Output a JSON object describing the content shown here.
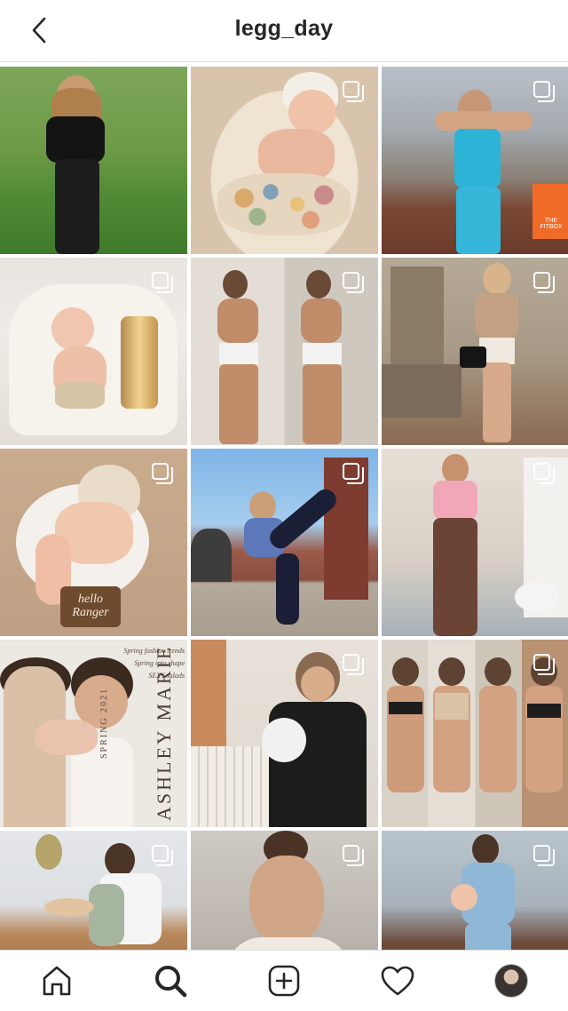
{
  "header": {
    "title": "legg_day"
  },
  "grid": {
    "tiles": [
      {
        "row": 1,
        "col": 1,
        "multi": false,
        "desc": "woman-black-top-garden"
      },
      {
        "row": 1,
        "col": 2,
        "multi": true,
        "desc": "baby-easter-eggs"
      },
      {
        "row": 1,
        "col": 3,
        "multi": true,
        "desc": "woman-flexing-fitbox"
      },
      {
        "row": 2,
        "col": 1,
        "multi": true,
        "desc": "baby-number-one-balloon"
      },
      {
        "row": 2,
        "col": 2,
        "multi": true,
        "desc": "pregnancy-mirror-selfie"
      },
      {
        "row": 2,
        "col": 3,
        "multi": true,
        "desc": "woman-porch-handbag"
      },
      {
        "row": 3,
        "col": 1,
        "multi": true,
        "desc": "newborn-hello-ranger"
      },
      {
        "row": 3,
        "col": 2,
        "multi": true,
        "desc": "woman-kicking-brick-wall"
      },
      {
        "row": 3,
        "col": 3,
        "multi": true,
        "desc": "woman-leggings-mirror"
      },
      {
        "row": 4,
        "col": 1,
        "multi": false,
        "desc": "magazine-cover-family"
      },
      {
        "row": 4,
        "col": 2,
        "multi": true,
        "desc": "woman-holding-newborn-nursery"
      },
      {
        "row": 4,
        "col": 3,
        "multi": true,
        "desc": "postpartum-progress-collage"
      },
      {
        "row": 5,
        "col": 1,
        "multi": true,
        "desc": "woman-baby-dining-table"
      },
      {
        "row": 5,
        "col": 2,
        "multi": true,
        "desc": "woman-selfie-car"
      },
      {
        "row": 5,
        "col": 3,
        "multi": true,
        "desc": "woman-baby-deck"
      }
    ],
    "magazine": {
      "lines": [
        "Spring fashion trends",
        "Spring into shape",
        "SEXY salads"
      ],
      "season": "SPRING 2021",
      "name": "ASHLEY MARIE"
    },
    "sign_text": "hello Ranger",
    "box_text": "THE FITBOX"
  },
  "nav": {
    "items": [
      "home-icon",
      "search-icon",
      "new-post-icon",
      "activity-heart-icon",
      "profile-avatar"
    ]
  },
  "colors": {
    "text": "#262626",
    "divider": "#dbdbdb",
    "background": "#ffffff"
  }
}
